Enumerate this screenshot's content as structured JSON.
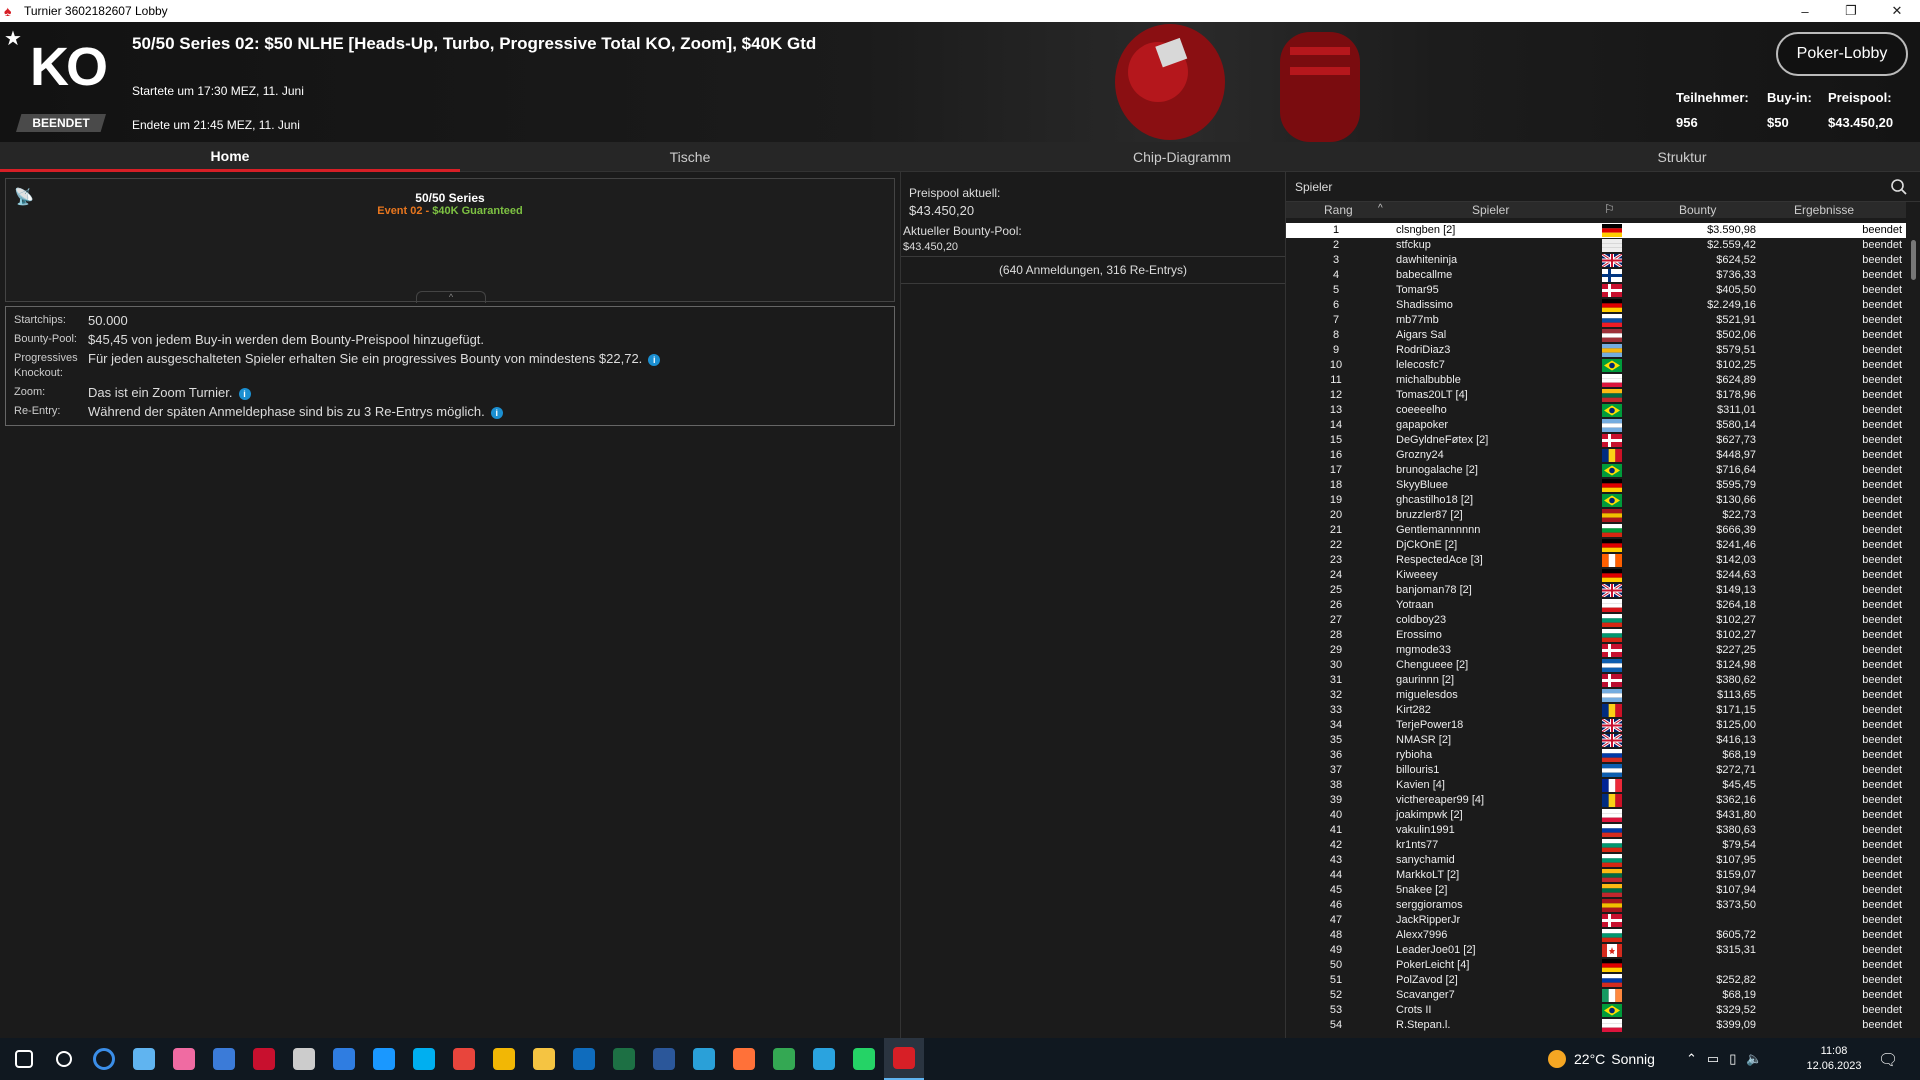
{
  "window": {
    "title": "Turnier 3602182607 Lobby",
    "minimize": "–",
    "restore": "❐",
    "close": "✕"
  },
  "header": {
    "logo_text": "KO",
    "status_badge": "BEENDET",
    "title": "50/50 Series 02: $50 NLHE [Heads-Up, Turbo, Progressive Total KO, Zoom], $40K Gtd",
    "started": "Startete um 17:30 MEZ, 11. Juni",
    "ended": "Endete um 21:45 MEZ, 11. Juni",
    "lobby_button": "Poker-Lobby",
    "participants_label": "Teilnehmer:",
    "participants_value": "956",
    "buyin_label": "Buy-in:",
    "buyin_value": "$50",
    "prizepool_label": "Preispool:",
    "prizepool_value": "$43.450,20"
  },
  "tabs": [
    {
      "label": "Home"
    },
    {
      "label": "Tische"
    },
    {
      "label": "Chip-Diagramm"
    },
    {
      "label": "Struktur"
    }
  ],
  "series": {
    "title": "50/50 Series",
    "event": "Event 02",
    "separator": " - ",
    "guarantee": "$40K Guaranteed"
  },
  "info": [
    {
      "key": "Startchips:",
      "value": "50.000",
      "info_icon": false
    },
    {
      "key": "Bounty-Pool:",
      "value": "$45,45 von jedem Buy-in werden dem Bounty-Preispool hinzugefügt.",
      "info_icon": false
    },
    {
      "key": "Progressives Knockout:",
      "value": "Für jeden ausgeschalteten Spieler erhalten Sie ein progressives Bounty von mindestens $22,72.",
      "info_icon": true
    },
    {
      "key": "Zoom:",
      "value": "Das ist ein Zoom Turnier.",
      "info_icon": true
    },
    {
      "key": "Re-Entry:",
      "value": "Während der späten Anmeldephase sind bis zu 3 Re-Entrys möglich.",
      "info_icon": true
    }
  ],
  "pool": {
    "current_label": "Preispool aktuell:",
    "current_value": "$43.450,20",
    "bounty_label": "Aktueller Bounty-Pool:",
    "bounty_value": "$43.450,20",
    "registrations": "(640 Anmeldungen, 316 Re-Entrys)"
  },
  "players": {
    "search_label": "Spieler",
    "columns": {
      "rank": "Rang",
      "player": "Spieler",
      "bounty": "Bounty",
      "result": "Ergebnisse"
    },
    "rows": [
      {
        "rank": "1",
        "name": "clsngben [2]",
        "flag": [
          "#000",
          "#dd0000",
          "#ffce00"
        ],
        "bounty": "$3.590,98",
        "result": "beendet"
      },
      {
        "rank": "2",
        "name": "stfckup",
        "flag": [
          "#eee",
          "#eee",
          "#eee"
        ],
        "bounty": "$2.559,42",
        "result": "beendet"
      },
      {
        "rank": "3",
        "name": "dawhiteninja",
        "flag": [
          "uk"
        ],
        "bounty": "$624,52",
        "result": "beendet"
      },
      {
        "rank": "4",
        "name": "babecallme",
        "flag": [
          "nordic",
          "#fff",
          "#003580"
        ],
        "bounty": "$736,33",
        "result": "beendet"
      },
      {
        "rank": "5",
        "name": "Tomar95",
        "flag": [
          "nordic",
          "#c8102e",
          "#fff"
        ],
        "bounty": "$405,50",
        "result": "beendet"
      },
      {
        "rank": "6",
        "name": "Shadissimo",
        "flag": [
          "#000",
          "#dd0000",
          "#ffce00"
        ],
        "bounty": "$2.249,16",
        "result": "beendet"
      },
      {
        "rank": "7",
        "name": "mb77mb",
        "flag": [
          "#fff",
          "#0b4ea2",
          "#ee1c25"
        ],
        "bounty": "$521,91",
        "result": "beendet"
      },
      {
        "rank": "8",
        "name": "Aigars Sal",
        "flag": [
          "#9e3039",
          "#fff",
          "#9e3039"
        ],
        "bounty": "$502,06",
        "result": "beendet"
      },
      {
        "rank": "9",
        "name": "RodriDiaz3",
        "flag": [
          "#74acdf",
          "#f6b40e",
          "#74acdf"
        ],
        "bounty": "$579,51",
        "result": "beendet"
      },
      {
        "rank": "10",
        "name": "lelecosfc7",
        "flag": [
          "br"
        ],
        "bounty": "$102,25",
        "result": "beendet"
      },
      {
        "rank": "11",
        "name": "michalbubble",
        "flag": [
          "#fff",
          "#fff",
          "#dc143c"
        ],
        "bounty": "$624,89",
        "result": "beendet"
      },
      {
        "rank": "12",
        "name": "Tomas20LT [4]",
        "flag": [
          "#fdb913",
          "#006a44",
          "#c1272d"
        ],
        "bounty": "$178,96",
        "result": "beendet"
      },
      {
        "rank": "13",
        "name": "coeeeelho",
        "flag": [
          "br"
        ],
        "bounty": "$311,01",
        "result": "beendet"
      },
      {
        "rank": "14",
        "name": "gapapoker",
        "flag": [
          "#74acdf",
          "#fff",
          "#74acdf"
        ],
        "bounty": "$580,14",
        "result": "beendet"
      },
      {
        "rank": "15",
        "name": "DeGyldneFøtex [2]",
        "flag": [
          "nordic",
          "#c8102e",
          "#fff"
        ],
        "bounty": "$627,73",
        "result": "beendet"
      },
      {
        "rank": "16",
        "name": "Grozny24",
        "flag": [
          "v",
          "#002b7f",
          "#fcd116",
          "#ce1126"
        ],
        "bounty": "$448,97",
        "result": "beendet"
      },
      {
        "rank": "17",
        "name": "brunogalache [2]",
        "flag": [
          "br"
        ],
        "bounty": "$716,64",
        "result": "beendet"
      },
      {
        "rank": "18",
        "name": "SkyyBluee",
        "flag": [
          "#000",
          "#dd0000",
          "#ffce00"
        ],
        "bounty": "$595,79",
        "result": "beendet"
      },
      {
        "rank": "19",
        "name": "ghcastilho18 [2]",
        "flag": [
          "br"
        ],
        "bounty": "$130,66",
        "result": "beendet"
      },
      {
        "rank": "20",
        "name": "bruzzler87 [2]",
        "flag": [
          "#aa151b",
          "#f1bf00",
          "#aa151b"
        ],
        "bounty": "$22,73",
        "result": "beendet"
      },
      {
        "rank": "21",
        "name": "Gentlemannnnnn",
        "flag": [
          "#fff",
          "#009b3a",
          "#d62612"
        ],
        "bounty": "$666,39",
        "result": "beendet"
      },
      {
        "rank": "22",
        "name": "DjCkOnE [2]",
        "flag": [
          "#000",
          "#dd0000",
          "#ffce00"
        ],
        "bounty": "$241,46",
        "result": "beendet"
      },
      {
        "rank": "23",
        "name": "RespectedAce [3]",
        "flag": [
          "v",
          "#ff5f00",
          "#fff",
          "#ff5f00"
        ],
        "bounty": "$142,03",
        "result": "beendet"
      },
      {
        "rank": "24",
        "name": "Kiweeey",
        "flag": [
          "#000",
          "#dd0000",
          "#ffce00"
        ],
        "bounty": "$244,63",
        "result": "beendet"
      },
      {
        "rank": "25",
        "name": "banjoman78 [2]",
        "flag": [
          "uk"
        ],
        "bounty": "$149,13",
        "result": "beendet"
      },
      {
        "rank": "26",
        "name": "Yotraan",
        "flag": [
          "#fff",
          "#fff",
          "#d7141a"
        ],
        "bounty": "$264,18",
        "result": "beendet"
      },
      {
        "rank": "27",
        "name": "coldboy23",
        "flag": [
          "#fff",
          "#00966e",
          "#d62612"
        ],
        "bounty": "$102,27",
        "result": "beendet"
      },
      {
        "rank": "28",
        "name": "Erossimo",
        "flag": [
          "#fff",
          "#00966e",
          "#d62612"
        ],
        "bounty": "$102,27",
        "result": "beendet"
      },
      {
        "rank": "29",
        "name": "mgmode33",
        "flag": [
          "nordic",
          "#c8102e",
          "#fff"
        ],
        "bounty": "$227,25",
        "result": "beendet"
      },
      {
        "rank": "30",
        "name": "Chengueee [2]",
        "flag": [
          "#0d5eaf",
          "#fff",
          "#0d5eaf"
        ],
        "bounty": "$124,98",
        "result": "beendet"
      },
      {
        "rank": "31",
        "name": "gaurinnn [2]",
        "flag": [
          "nordic",
          "#ba0c2f",
          "#fff"
        ],
        "bounty": "$380,62",
        "result": "beendet"
      },
      {
        "rank": "32",
        "name": "miguelesdos",
        "flag": [
          "#74acdf",
          "#fff",
          "#74acdf"
        ],
        "bounty": "$113,65",
        "result": "beendet"
      },
      {
        "rank": "33",
        "name": "Kirt282",
        "flag": [
          "v",
          "#002b7f",
          "#fcd116",
          "#ce1126"
        ],
        "bounty": "$171,15",
        "result": "beendet"
      },
      {
        "rank": "34",
        "name": "TerjePower18",
        "flag": [
          "uk"
        ],
        "bounty": "$125,00",
        "result": "beendet"
      },
      {
        "rank": "35",
        "name": "NMASR [2]",
        "flag": [
          "uk"
        ],
        "bounty": "$416,13",
        "result": "beendet"
      },
      {
        "rank": "36",
        "name": "rybioha",
        "flag": [
          "#fff",
          "#0039a6",
          "#d52b1e"
        ],
        "bounty": "$68,19",
        "result": "beendet"
      },
      {
        "rank": "37",
        "name": "billouris1",
        "flag": [
          "#0d5eaf",
          "#fff",
          "#0d5eaf"
        ],
        "bounty": "$272,71",
        "result": "beendet"
      },
      {
        "rank": "38",
        "name": "Kavien [4]",
        "flag": [
          "v",
          "#002395",
          "#fff",
          "#ed2939"
        ],
        "bounty": "$45,45",
        "result": "beendet"
      },
      {
        "rank": "39",
        "name": "victhereaper99 [4]",
        "flag": [
          "v",
          "#002b7f",
          "#fcd116",
          "#ce1126"
        ],
        "bounty": "$362,16",
        "result": "beendet"
      },
      {
        "rank": "40",
        "name": "joakimpwk [2]",
        "flag": [
          "#fff",
          "#fff",
          "#dc143c"
        ],
        "bounty": "$431,80",
        "result": "beendet"
      },
      {
        "rank": "41",
        "name": "vakulin1991",
        "flag": [
          "#fff",
          "#0039a6",
          "#d52b1e"
        ],
        "bounty": "$380,63",
        "result": "beendet"
      },
      {
        "rank": "42",
        "name": "kr1nts77",
        "flag": [
          "#fff",
          "#00966e",
          "#d62612"
        ],
        "bounty": "$79,54",
        "result": "beendet"
      },
      {
        "rank": "43",
        "name": "sanychamid",
        "flag": [
          "#fff",
          "#00966e",
          "#d62612"
        ],
        "bounty": "$107,95",
        "result": "beendet"
      },
      {
        "rank": "44",
        "name": "MarkkoLT [2]",
        "flag": [
          "#fdb913",
          "#006a44",
          "#c1272d"
        ],
        "bounty": "$159,07",
        "result": "beendet"
      },
      {
        "rank": "45",
        "name": "5nakee [2]",
        "flag": [
          "#fdb913",
          "#006a44",
          "#c1272d"
        ],
        "bounty": "$107,94",
        "result": "beendet"
      },
      {
        "rank": "46",
        "name": "serggioramos",
        "flag": [
          "#aa151b",
          "#f1bf00",
          "#aa151b"
        ],
        "bounty": "$373,50",
        "result": "beendet"
      },
      {
        "rank": "47",
        "name": "JackRipperJr",
        "flag": [
          "nordic",
          "#c8102e",
          "#fff"
        ],
        "bounty": "",
        "result": "beendet"
      },
      {
        "rank": "48",
        "name": "Alexx7996",
        "flag": [
          "#fff",
          "#00966e",
          "#d62612"
        ],
        "bounty": "$605,72",
        "result": "beendet"
      },
      {
        "rank": "49",
        "name": "LeaderJoe01 [2]",
        "flag": [
          "ca"
        ],
        "bounty": "$315,31",
        "result": "beendet"
      },
      {
        "rank": "50",
        "name": "PokerLeicht [4]",
        "flag": [
          "#000",
          "#dd0000",
          "#ffce00"
        ],
        "bounty": "",
        "result": "beendet"
      },
      {
        "rank": "51",
        "name": "PolZavod [2]",
        "flag": [
          "#fff",
          "#0039a6",
          "#d52b1e"
        ],
        "bounty": "$252,82",
        "result": "beendet"
      },
      {
        "rank": "52",
        "name": "Scavanger7",
        "flag": [
          "v",
          "#169b62",
          "#fff",
          "#ff883e"
        ],
        "bounty": "$68,19",
        "result": "beendet"
      },
      {
        "rank": "53",
        "name": "Crots II",
        "flag": [
          "br"
        ],
        "bounty": "$329,52",
        "result": "beendet"
      },
      {
        "rank": "54",
        "name": "R.Stepan.l.",
        "flag": [
          "#fff",
          "#fff",
          "#dc143c"
        ],
        "bounty": "$399,09",
        "result": "beendet"
      }
    ]
  },
  "taskbar": {
    "icons": [
      {
        "name": "start-icon",
        "color": "#ffffff"
      },
      {
        "name": "search-icon",
        "color": "#ffffff"
      },
      {
        "name": "cortana-icon",
        "color": "#3b8ee8"
      },
      {
        "name": "onedrive-icon",
        "color": "#60b4f0"
      },
      {
        "name": "itunes-icon",
        "color": "#f06ba2"
      },
      {
        "name": "vpn-icon",
        "color": "#3b7bd8"
      },
      {
        "name": "mcafee-icon",
        "color": "#c8102e"
      },
      {
        "name": "gg-icon",
        "color": "#cccccc"
      },
      {
        "name": "sky-icon",
        "color": "#2f7de1"
      },
      {
        "name": "prime-video-icon",
        "color": "#1a98ff"
      },
      {
        "name": "skype-icon",
        "color": "#00aff0"
      },
      {
        "name": "chrome-icon",
        "color": "#e8453c"
      },
      {
        "name": "chrome-alt-icon",
        "color": "#f2b705"
      },
      {
        "name": "file-explorer-icon",
        "color": "#f5c442"
      },
      {
        "name": "outlook-icon",
        "color": "#0f6cbd"
      },
      {
        "name": "excel-icon",
        "color": "#1d7044"
      },
      {
        "name": "word-icon",
        "color": "#2b579a"
      },
      {
        "name": "edge-icon",
        "color": "#2aa0d8"
      },
      {
        "name": "firefox-icon",
        "color": "#ff7139"
      },
      {
        "name": "chrome-profile-icon",
        "color": "#34a853"
      },
      {
        "name": "telegram-icon",
        "color": "#2aa3df"
      },
      {
        "name": "whatsapp-icon",
        "color": "#25d366"
      },
      {
        "name": "pokerstars-icon",
        "color": "#d71f26"
      }
    ],
    "temperature": "22°C",
    "weather": "Sonnig",
    "time": "11:08",
    "date": "12.06.2023"
  }
}
